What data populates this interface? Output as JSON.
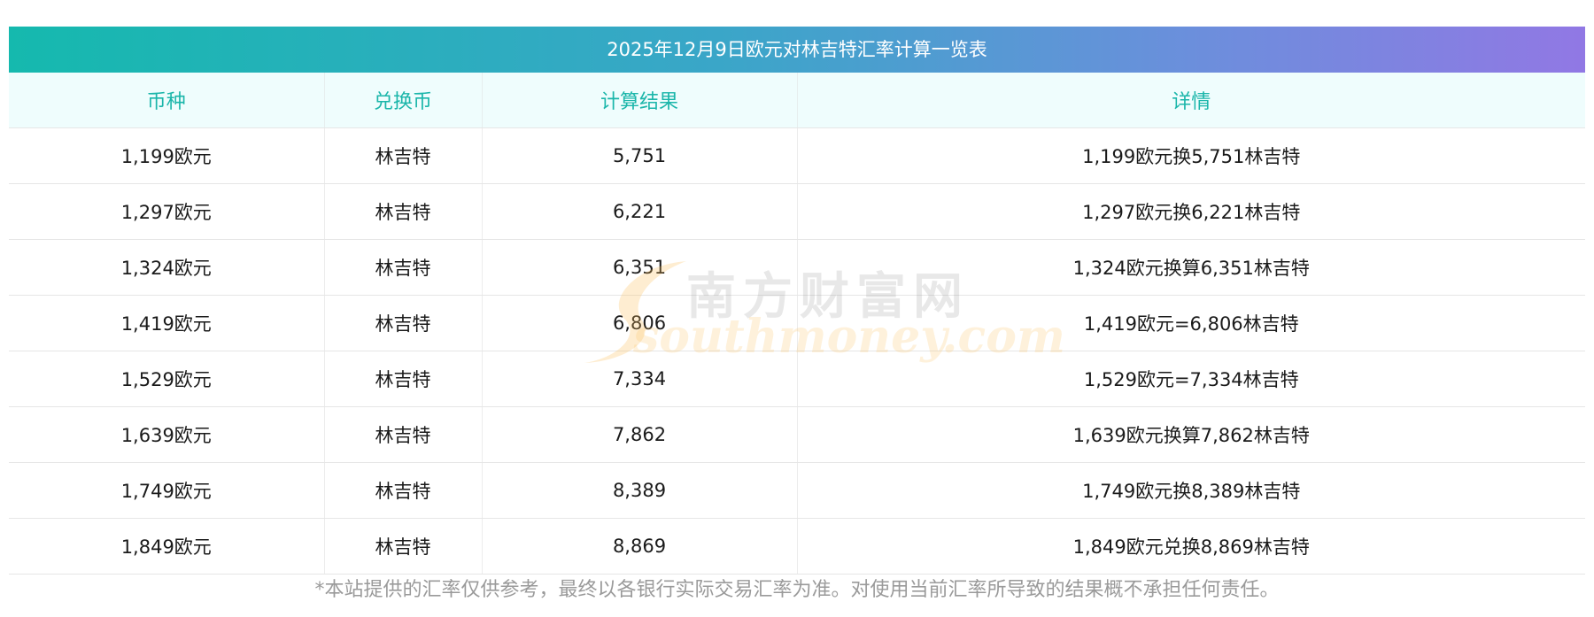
{
  "title": "2025年12月9日欧元对林吉特汇率计算一览表",
  "headers": [
    "币种",
    "兑换币",
    "计算结果",
    "详情"
  ],
  "rows": [
    {
      "currency": "1,199欧元",
      "target": "林吉特",
      "result": "5,751",
      "detail": "1,199欧元换5,751林吉特"
    },
    {
      "currency": "1,297欧元",
      "target": "林吉特",
      "result": "6,221",
      "detail": "1,297欧元换6,221林吉特"
    },
    {
      "currency": "1,324欧元",
      "target": "林吉特",
      "result": "6,351",
      "detail": "1,324欧元换算6,351林吉特"
    },
    {
      "currency": "1,419欧元",
      "target": "林吉特",
      "result": "6,806",
      "detail": "1,419欧元=6,806林吉特"
    },
    {
      "currency": "1,529欧元",
      "target": "林吉特",
      "result": "7,334",
      "detail": "1,529欧元=7,334林吉特"
    },
    {
      "currency": "1,639欧元",
      "target": "林吉特",
      "result": "7,862",
      "detail": "1,639欧元换算7,862林吉特"
    },
    {
      "currency": "1,749欧元",
      "target": "林吉特",
      "result": "8,389",
      "detail": "1,749欧元换8,389林吉特"
    },
    {
      "currency": "1,849欧元",
      "target": "林吉特",
      "result": "8,869",
      "detail": "1,849欧元兑换8,869林吉特"
    }
  ],
  "watermark": {
    "cn": "南方财富网",
    "en": "southmoney.com"
  },
  "footnote": "*本站提供的汇率仅供参考，最终以各银行实际交易汇率为准。对使用当前汇率所导致的结果概不承担任何责任。",
  "colors": {
    "title_gradient_start": "#15b9ae",
    "title_gradient_end": "#9178e4",
    "header_text": "#1bb6aa",
    "header_bg": "#effdfd"
  }
}
